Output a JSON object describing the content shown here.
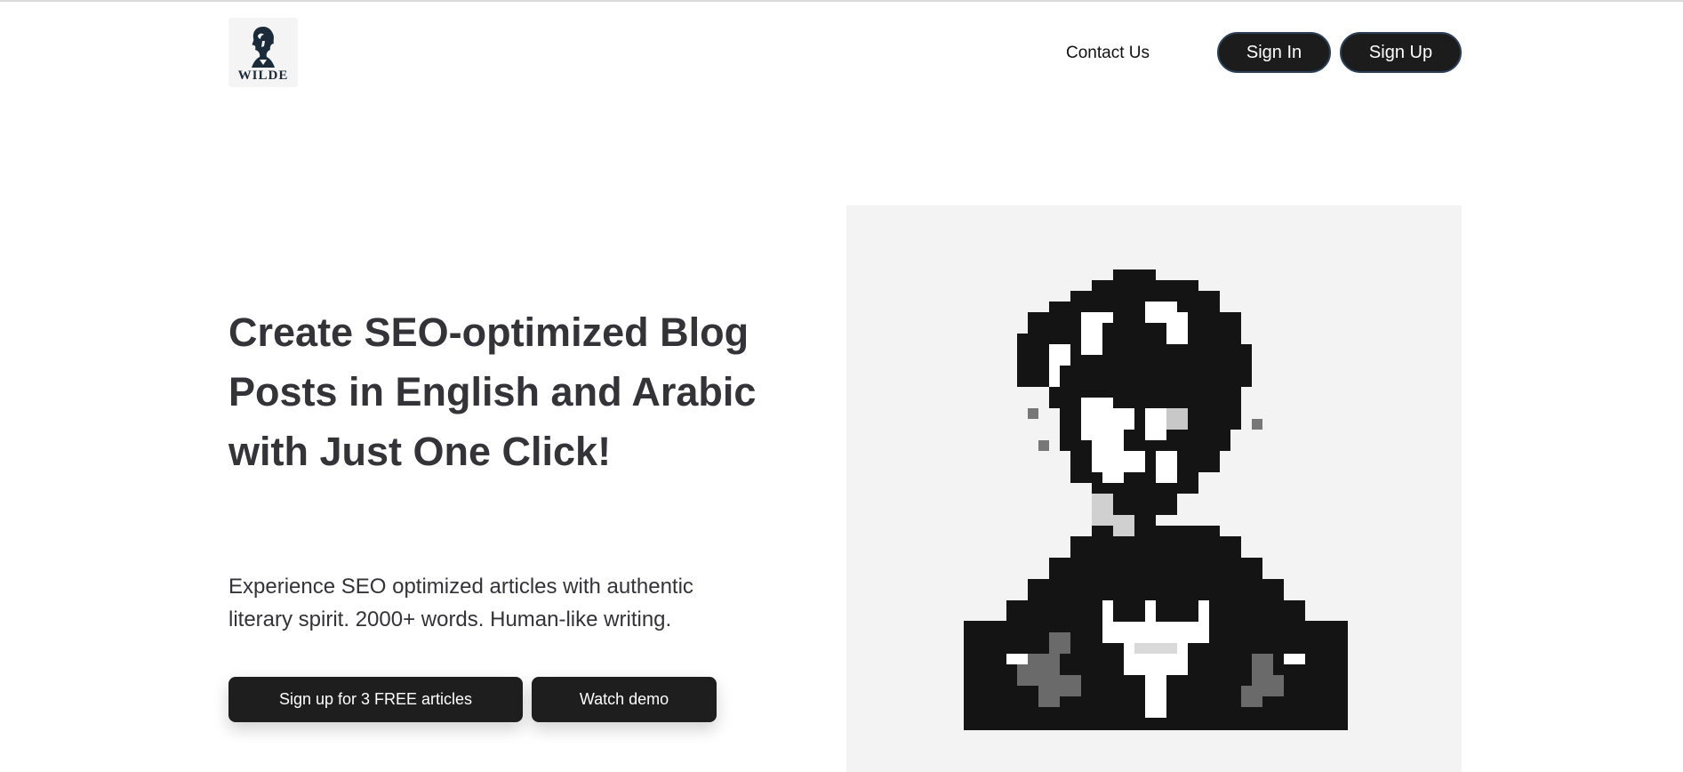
{
  "header": {
    "logo_text": "WILDE",
    "nav": {
      "contact_label": "Contact Us"
    },
    "auth": {
      "signin_label": "Sign In",
      "signup_label": "Sign Up"
    }
  },
  "hero": {
    "title": "Create SEO-optimized Blog Posts in English and Arabic with Just One Click!",
    "subtitle": "Experience SEO optimized articles with authentic literary spirit. 2000+ words. Human-like writing.",
    "cta_label": "Sign up for 3 FREE articles",
    "demo_label": "Watch demo"
  },
  "colors": {
    "button_bg": "#1c1c1c",
    "button_border": "#2b3f56",
    "heading": "#333338",
    "portrait_bg": "#f3f3f3"
  },
  "icons": {
    "logo": "wilde-bust-logo",
    "portrait": "pixel-art-portrait"
  }
}
